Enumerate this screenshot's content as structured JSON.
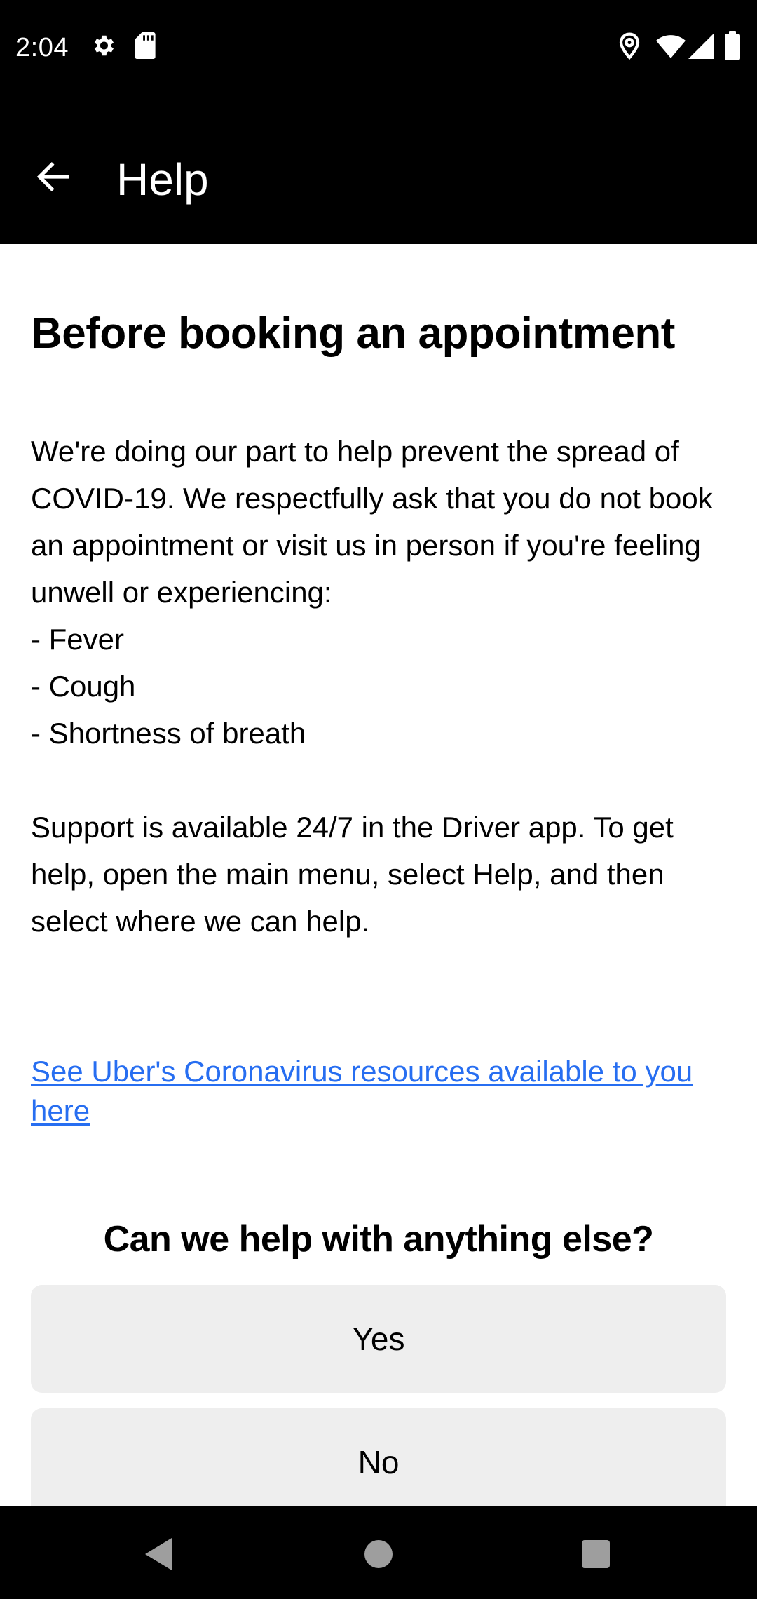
{
  "status_bar": {
    "time": "2:04",
    "icons": [
      "gear-icon",
      "sd-card-icon",
      "location-icon",
      "wifi-icon",
      "signal-icon",
      "battery-icon"
    ]
  },
  "app_bar": {
    "back_icon": "arrow-left-icon",
    "title": "Help"
  },
  "article": {
    "heading": "Before booking an appointment",
    "body": "We're doing our part to help prevent the spread of COVID-19. We respectfully ask that you do not book an appointment or visit us in person if you're feeling unwell or experiencing:\n- Fever\n- Cough\n- Shortness of breath\n\nSupport is available 24/7 in the Driver app. To get help, open the main menu, select Help, and then select where we can help.",
    "link_text": "See Uber's Coronavirus resources available to you here"
  },
  "feedback": {
    "question": "Can we help with anything else?",
    "yes_label": "Yes",
    "no_label": "No"
  },
  "nav_bar": {
    "icons": [
      "back-triangle-icon",
      "home-circle-icon",
      "recents-square-icon"
    ]
  },
  "colors": {
    "link": "#276ef1",
    "button_bg": "#eeeeee",
    "bar_bg": "#000000"
  }
}
